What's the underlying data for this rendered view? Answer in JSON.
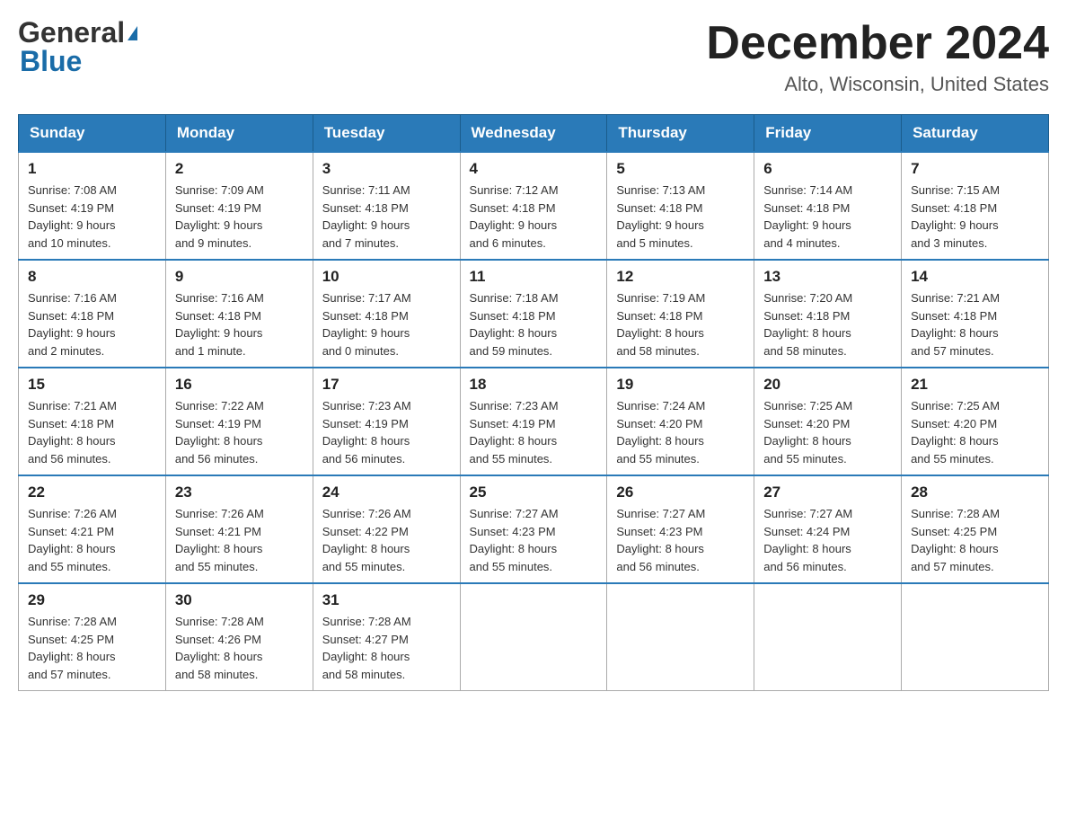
{
  "header": {
    "logo_general": "General",
    "logo_blue": "Blue",
    "month_title": "December 2024",
    "location": "Alto, Wisconsin, United States"
  },
  "days_of_week": [
    "Sunday",
    "Monday",
    "Tuesday",
    "Wednesday",
    "Thursday",
    "Friday",
    "Saturday"
  ],
  "weeks": [
    [
      {
        "day": "1",
        "sunrise": "7:08 AM",
        "sunset": "4:19 PM",
        "daylight": "9 hours and 10 minutes."
      },
      {
        "day": "2",
        "sunrise": "7:09 AM",
        "sunset": "4:19 PM",
        "daylight": "9 hours and 9 minutes."
      },
      {
        "day": "3",
        "sunrise": "7:11 AM",
        "sunset": "4:18 PM",
        "daylight": "9 hours and 7 minutes."
      },
      {
        "day": "4",
        "sunrise": "7:12 AM",
        "sunset": "4:18 PM",
        "daylight": "9 hours and 6 minutes."
      },
      {
        "day": "5",
        "sunrise": "7:13 AM",
        "sunset": "4:18 PM",
        "daylight": "9 hours and 5 minutes."
      },
      {
        "day": "6",
        "sunrise": "7:14 AM",
        "sunset": "4:18 PM",
        "daylight": "9 hours and 4 minutes."
      },
      {
        "day": "7",
        "sunrise": "7:15 AM",
        "sunset": "4:18 PM",
        "daylight": "9 hours and 3 minutes."
      }
    ],
    [
      {
        "day": "8",
        "sunrise": "7:16 AM",
        "sunset": "4:18 PM",
        "daylight": "9 hours and 2 minutes."
      },
      {
        "day": "9",
        "sunrise": "7:16 AM",
        "sunset": "4:18 PM",
        "daylight": "9 hours and 1 minute."
      },
      {
        "day": "10",
        "sunrise": "7:17 AM",
        "sunset": "4:18 PM",
        "daylight": "9 hours and 0 minutes."
      },
      {
        "day": "11",
        "sunrise": "7:18 AM",
        "sunset": "4:18 PM",
        "daylight": "8 hours and 59 minutes."
      },
      {
        "day": "12",
        "sunrise": "7:19 AM",
        "sunset": "4:18 PM",
        "daylight": "8 hours and 58 minutes."
      },
      {
        "day": "13",
        "sunrise": "7:20 AM",
        "sunset": "4:18 PM",
        "daylight": "8 hours and 58 minutes."
      },
      {
        "day": "14",
        "sunrise": "7:21 AM",
        "sunset": "4:18 PM",
        "daylight": "8 hours and 57 minutes."
      }
    ],
    [
      {
        "day": "15",
        "sunrise": "7:21 AM",
        "sunset": "4:18 PM",
        "daylight": "8 hours and 56 minutes."
      },
      {
        "day": "16",
        "sunrise": "7:22 AM",
        "sunset": "4:19 PM",
        "daylight": "8 hours and 56 minutes."
      },
      {
        "day": "17",
        "sunrise": "7:23 AM",
        "sunset": "4:19 PM",
        "daylight": "8 hours and 56 minutes."
      },
      {
        "day": "18",
        "sunrise": "7:23 AM",
        "sunset": "4:19 PM",
        "daylight": "8 hours and 55 minutes."
      },
      {
        "day": "19",
        "sunrise": "7:24 AM",
        "sunset": "4:20 PM",
        "daylight": "8 hours and 55 minutes."
      },
      {
        "day": "20",
        "sunrise": "7:25 AM",
        "sunset": "4:20 PM",
        "daylight": "8 hours and 55 minutes."
      },
      {
        "day": "21",
        "sunrise": "7:25 AM",
        "sunset": "4:20 PM",
        "daylight": "8 hours and 55 minutes."
      }
    ],
    [
      {
        "day": "22",
        "sunrise": "7:26 AM",
        "sunset": "4:21 PM",
        "daylight": "8 hours and 55 minutes."
      },
      {
        "day": "23",
        "sunrise": "7:26 AM",
        "sunset": "4:21 PM",
        "daylight": "8 hours and 55 minutes."
      },
      {
        "day": "24",
        "sunrise": "7:26 AM",
        "sunset": "4:22 PM",
        "daylight": "8 hours and 55 minutes."
      },
      {
        "day": "25",
        "sunrise": "7:27 AM",
        "sunset": "4:23 PM",
        "daylight": "8 hours and 55 minutes."
      },
      {
        "day": "26",
        "sunrise": "7:27 AM",
        "sunset": "4:23 PM",
        "daylight": "8 hours and 56 minutes."
      },
      {
        "day": "27",
        "sunrise": "7:27 AM",
        "sunset": "4:24 PM",
        "daylight": "8 hours and 56 minutes."
      },
      {
        "day": "28",
        "sunrise": "7:28 AM",
        "sunset": "4:25 PM",
        "daylight": "8 hours and 57 minutes."
      }
    ],
    [
      {
        "day": "29",
        "sunrise": "7:28 AM",
        "sunset": "4:25 PM",
        "daylight": "8 hours and 57 minutes."
      },
      {
        "day": "30",
        "sunrise": "7:28 AM",
        "sunset": "4:26 PM",
        "daylight": "8 hours and 58 minutes."
      },
      {
        "day": "31",
        "sunrise": "7:28 AM",
        "sunset": "4:27 PM",
        "daylight": "8 hours and 58 minutes."
      },
      null,
      null,
      null,
      null
    ]
  ],
  "labels": {
    "sunrise": "Sunrise:",
    "sunset": "Sunset:",
    "daylight": "Daylight:"
  }
}
